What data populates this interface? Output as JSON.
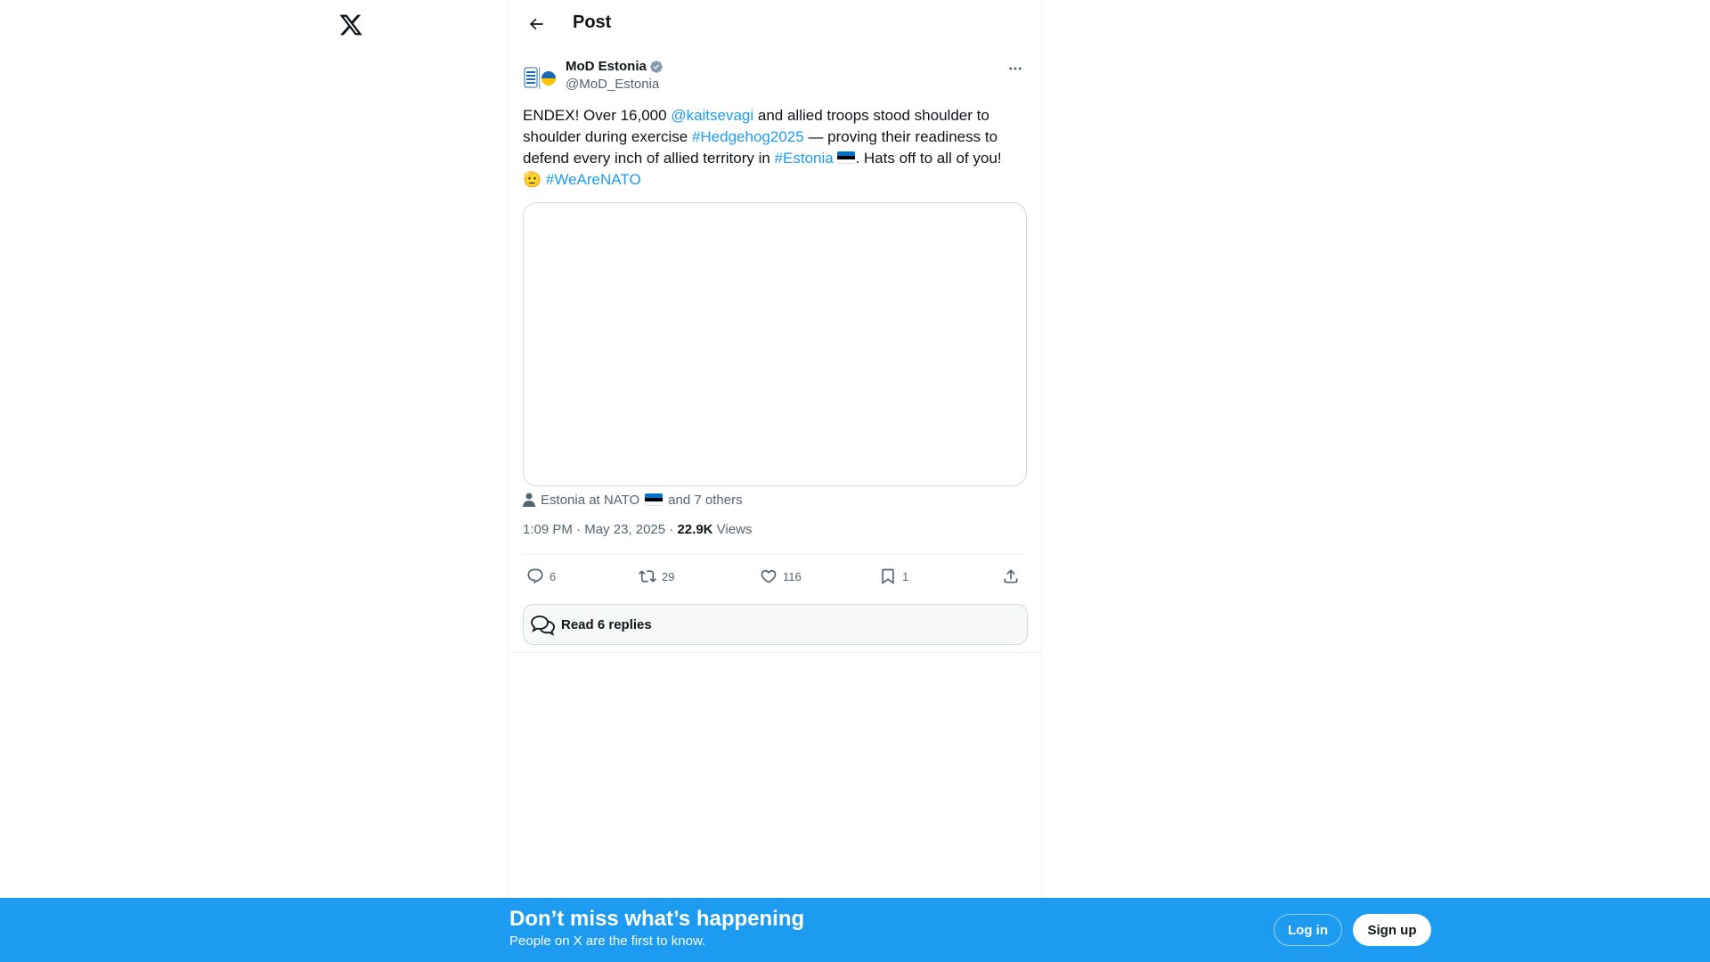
{
  "header": {
    "title": "Post"
  },
  "author": {
    "name": "MoD Estonia",
    "handle": "@MoD_Estonia",
    "verified": true
  },
  "post": {
    "t1": "ENDEX! Over 16,000 ",
    "mention": "@kaitsevagi",
    "t2": " and allied troops stood shoulder to shoulder during exercise ",
    "hashtag1": "#Hedgehog2025",
    "t3": " — proving their readiness to defend every inch of allied territory in ",
    "hashtag2": "#Estonia",
    "t4": ". Hats off to all of you! ",
    "emoji": "🫡",
    "hashtag3": "#WeAreNATO"
  },
  "tagged": {
    "first": "Estonia at NATO",
    "rest": "and 7 others"
  },
  "meta": {
    "time": "1:09 PM",
    "date": "May 23, 2025",
    "views_count": "22.9K",
    "views_label": "Views"
  },
  "actions": {
    "replies": "6",
    "reposts": "29",
    "likes": "116",
    "bookmarks": "1"
  },
  "read_replies": "Read 6 replies",
  "banner": {
    "title": "Don’t miss what’s happening",
    "subtitle": "People on X are the first to know.",
    "login": "Log in",
    "signup": "Sign up"
  },
  "colors": {
    "accent": "#1d9bf0",
    "text": "#0f1419",
    "muted": "#536471",
    "border": "#cfd9de"
  },
  "icons": [
    "x-logo-icon",
    "back-arrow-icon",
    "verified-badge-icon",
    "more-icon",
    "person-icon",
    "reply-icon",
    "repost-icon",
    "like-icon",
    "bookmark-icon",
    "share-icon",
    "replies-bubble-icon",
    "flag-estonia-icon"
  ]
}
